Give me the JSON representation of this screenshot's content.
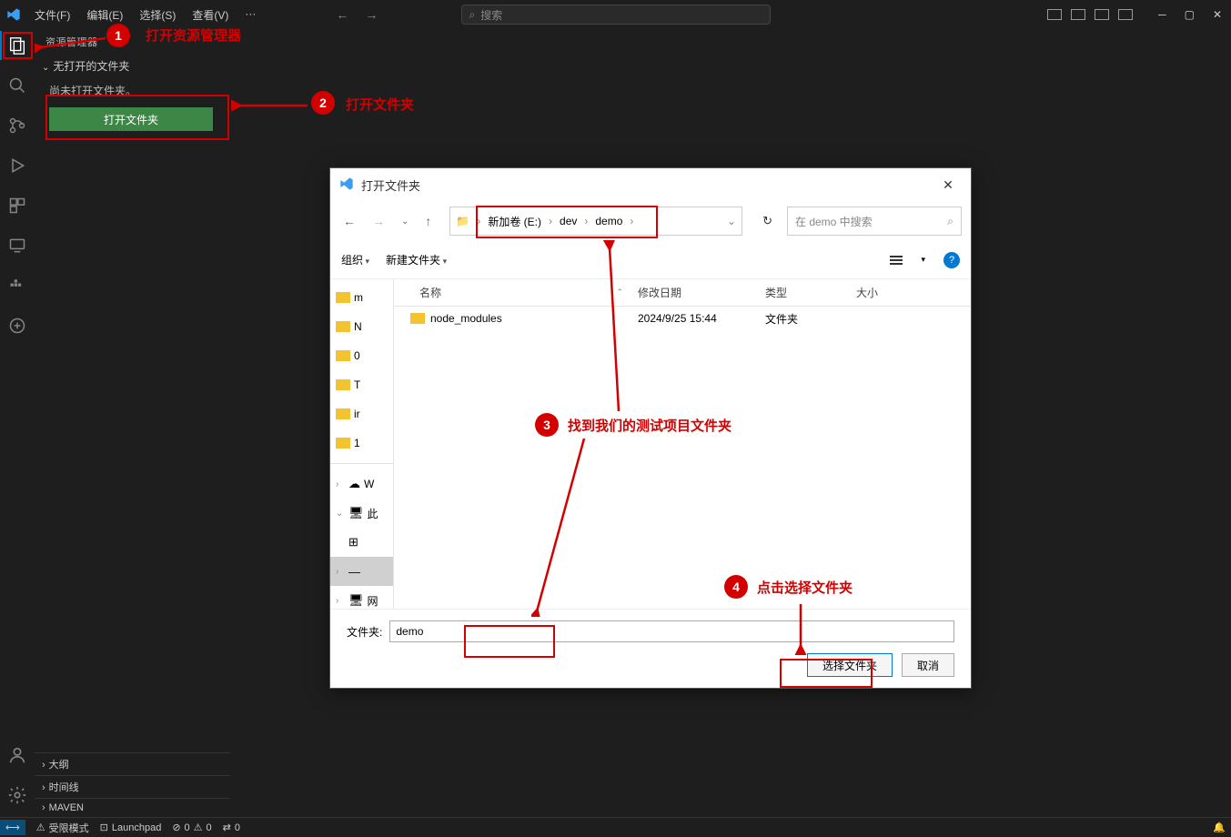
{
  "titlebar": {
    "menus": [
      "文件(F)",
      "编辑(E)",
      "选择(S)",
      "查看(V)"
    ],
    "dots": "···",
    "search_placeholder": "搜索"
  },
  "sidebar": {
    "header": "资源管理器",
    "no_folder_title": "无打开的文件夹",
    "no_folder_msg": "尚未打开文件夹。",
    "open_folder_btn": "打开文件夹",
    "sections": [
      "大纲",
      "时间线",
      "MAVEN"
    ]
  },
  "statusbar": {
    "remote": "✕",
    "restricted": "受限模式",
    "launchpad": "Launchpad",
    "errors": "0",
    "warnings": "0",
    "ports": "0"
  },
  "dialog": {
    "title": "打开文件夹",
    "breadcrumb": [
      "新加卷 (E:)",
      "dev",
      "demo"
    ],
    "search_placeholder": "在 demo 中搜索",
    "toolbar": {
      "organize": "组织",
      "new_folder": "新建文件夹"
    },
    "columns": {
      "name": "名称",
      "date": "修改日期",
      "type": "类型",
      "size": "大小"
    },
    "rows": [
      {
        "name": "node_modules",
        "date": "2024/9/25 15:44",
        "type": "文件夹",
        "size": ""
      }
    ],
    "tree": [
      "m",
      "N",
      "0",
      "T",
      "ir",
      "1"
    ],
    "tree2": [
      {
        "chv": "›",
        "icon": "☁",
        "text": "W",
        "sel": false
      },
      {
        "chv": "⌄",
        "icon": "🖥",
        "text": "此",
        "sel": false
      },
      {
        "chv": "",
        "icon": "⊞",
        "text": "",
        "sel": false
      },
      {
        "chv": "›",
        "icon": "—",
        "text": "",
        "sel": true
      },
      {
        "chv": "›",
        "icon": "🖥",
        "text": "网",
        "sel": false
      }
    ],
    "folder_label": "文件夹:",
    "folder_value": "demo",
    "select_btn": "选择文件夹",
    "cancel_btn": "取消"
  },
  "annotations": {
    "1": "打开资源管理器",
    "2": "打开文件夹",
    "3": "找到我们的测试项目文件夹",
    "4": "点击选择文件夹"
  }
}
